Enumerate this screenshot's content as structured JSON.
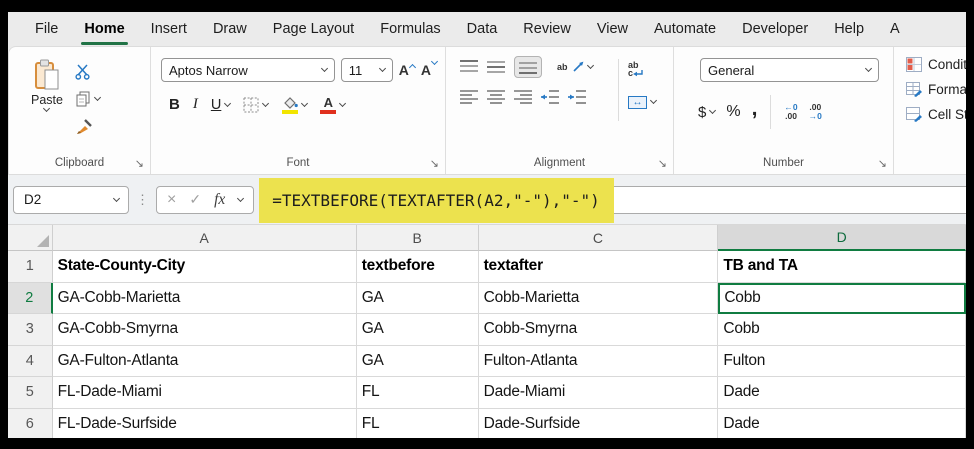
{
  "menu": {
    "items": [
      "File",
      "Home",
      "Insert",
      "Draw",
      "Page Layout",
      "Formulas",
      "Data",
      "Review",
      "View",
      "Automate",
      "Developer",
      "Help",
      "A"
    ],
    "active_item": "Home"
  },
  "ribbon": {
    "clipboard": {
      "label": "Clipboard",
      "paste": "Paste"
    },
    "font": {
      "label": "Font",
      "name": "Aptos Narrow",
      "size": "11",
      "bold": "B",
      "italic": "I",
      "underline": "U",
      "grow_letter": "A",
      "shrink_letter": "A",
      "color_letter": "A"
    },
    "alignment": {
      "label": "Alignment",
      "orientation_text": "ab",
      "wrap_line1": "ab",
      "wrap_line2": "c",
      "merge_glyph": "↔"
    },
    "number": {
      "label": "Number",
      "format": "General",
      "currency": "$",
      "percent": "%",
      "comma": ",",
      "inc_top": "←0",
      "inc_bottom": ".00",
      "dec_top": ".00",
      "dec_bottom": "→0"
    },
    "styles": {
      "conditional": "Condit",
      "format_table": "Format",
      "cell_styles": "Cell Sty"
    }
  },
  "formula_bar": {
    "name_box": "D2",
    "menu_dots": "⋮",
    "cancel": "×",
    "enter": "✓",
    "fx": "fx",
    "formula": "=TEXTBEFORE(TEXTAFTER(A2,\"-\"),\"-\")"
  },
  "sheet": {
    "col_headers": [
      "A",
      "B",
      "C",
      "D"
    ],
    "active_cell": "D2",
    "selected_column": "D",
    "selected_row": "2",
    "rows": [
      {
        "n": "1",
        "A": "State-County-City",
        "B": "textbefore",
        "C": "textafter",
        "D": "TB and TA"
      },
      {
        "n": "2",
        "A": "GA-Cobb-Marietta",
        "B": "GA",
        "C": "Cobb-Marietta",
        "D": "Cobb"
      },
      {
        "n": "3",
        "A": "GA-Cobb-Smyrna",
        "B": "GA",
        "C": "Cobb-Smyrna",
        "D": "Cobb"
      },
      {
        "n": "4",
        "A": "GA-Fulton-Atlanta",
        "B": "GA",
        "C": "Fulton-Atlanta",
        "D": "Fulton"
      },
      {
        "n": "5",
        "A": "FL-Dade-Miami",
        "B": "FL",
        "C": "Dade-Miami",
        "D": "Dade"
      },
      {
        "n": "6",
        "A": "FL-Dade-Surfside",
        "B": "FL",
        "C": "Dade-Surfside",
        "D": "Dade"
      }
    ]
  },
  "icons": {
    "launcher": "↘"
  },
  "colors": {
    "accent_green": "#107C41",
    "home_underline": "#217346",
    "formula_highlight": "#ECE24E",
    "font_color_red": "#E0301E",
    "fill_yellow": "#F2E500",
    "icon_blue": "#2779C4"
  }
}
